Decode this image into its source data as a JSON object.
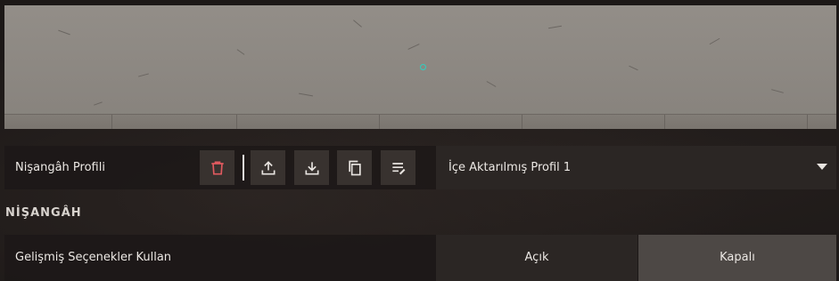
{
  "profile": {
    "label": "Nişangâh Profili",
    "selected_profile": "İçe Aktarılmış Profil 1",
    "toolbar": {
      "delete_icon": "trash-icon",
      "export_icon": "upload-icon",
      "import_icon": "download-icon",
      "copy_icon": "copy-icon",
      "rename_icon": "edit-list-icon",
      "delete_color": "#e05a5f"
    }
  },
  "section": {
    "title": "NİŞANGÂH"
  },
  "advanced": {
    "label": "Gelişmiş Seçenekler Kullan",
    "on_label": "Açık",
    "off_label": "Kapalı",
    "selected": "Kapalı"
  },
  "preview": {
    "crosshair_color": "#2fd0c0"
  }
}
